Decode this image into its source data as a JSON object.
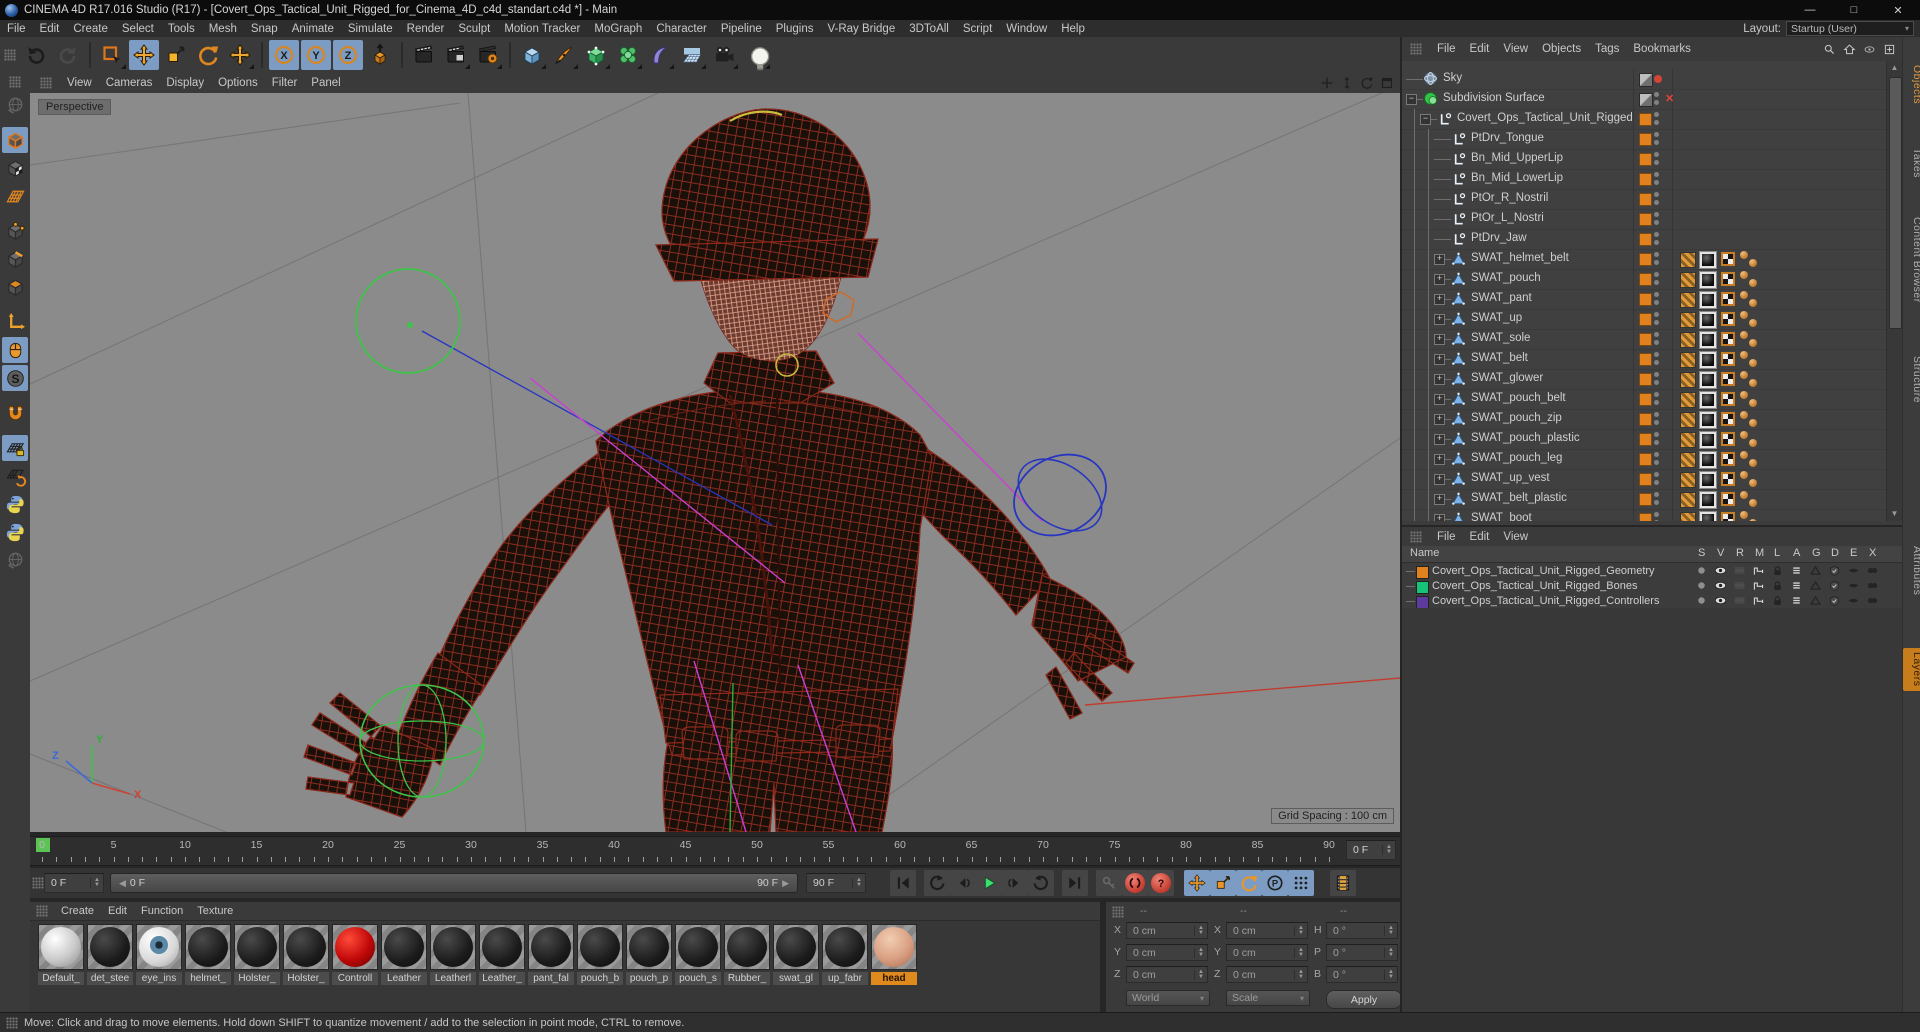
{
  "window": {
    "title": "CINEMA 4D R17.016 Studio (R17) - [Covert_Ops_Tactical_Unit_Rigged_for_Cinema_4D_c4d_standart.c4d *] - Main"
  },
  "menu_bar": {
    "items": [
      "File",
      "Edit",
      "Create",
      "Select",
      "Tools",
      "Mesh",
      "Snap",
      "Animate",
      "Simulate",
      "Render",
      "Sculpt",
      "Motion Tracker",
      "MoGraph",
      "Character",
      "Pipeline",
      "Plugins",
      "V-Ray Bridge",
      "3DToAll",
      "Script",
      "Window",
      "Help"
    ],
    "layout_label": "Layout:",
    "layout_value": "Startup (User)"
  },
  "toolbar": {
    "buttons": [
      {
        "name": "undo-button",
        "icon": "undo"
      },
      {
        "name": "redo-button",
        "icon": "redo",
        "state": "disabled"
      },
      {
        "sep": true
      },
      {
        "name": "selection-tool-button",
        "icon": "select",
        "corner": true
      },
      {
        "name": "move-tool-button",
        "icon": "move",
        "state": "active"
      },
      {
        "name": "scale-tool-button",
        "icon": "scale"
      },
      {
        "name": "rotate-tool-button",
        "icon": "rotate"
      },
      {
        "name": "last-used-tool-button",
        "icon": "move",
        "corner": true
      },
      {
        "sep": true
      },
      {
        "name": "lock-x-axis-button",
        "icon": "axisX",
        "state": "active"
      },
      {
        "name": "lock-y-axis-button",
        "icon": "axisY",
        "state": "active"
      },
      {
        "name": "lock-z-axis-button",
        "icon": "axisZ",
        "state": "active"
      },
      {
        "name": "coordinate-system-button",
        "icon": "cubearrow"
      },
      {
        "sep": true
      },
      {
        "name": "render-view-button",
        "icon": "clapper"
      },
      {
        "name": "render-picture-viewer-button",
        "icon": "clapperpv",
        "corner": true
      },
      {
        "name": "render-settings-button",
        "icon": "clappergear",
        "corner": true
      },
      {
        "sep": true
      },
      {
        "name": "add-cube-object-button",
        "icon": "cubeblue",
        "corner": true
      },
      {
        "name": "pen-spline-button",
        "icon": "pen",
        "corner": true
      },
      {
        "name": "subdivision-surface-button",
        "icon": "subdivgen",
        "corner": true
      },
      {
        "name": "array-generator-button",
        "icon": "cluster",
        "corner": true
      },
      {
        "name": "bend-deformer-button",
        "icon": "bend",
        "corner": true
      },
      {
        "name": "floor-environment-button",
        "icon": "floor",
        "corner": true
      },
      {
        "name": "camera-button",
        "icon": "camera",
        "corner": true
      },
      {
        "name": "light-button",
        "icon": "light",
        "corner": true
      }
    ]
  },
  "tool_palette": {
    "buttons": [
      {
        "name": "convert-tool-button",
        "icon": "globe",
        "state": "disabled"
      },
      {
        "gap": true
      },
      {
        "name": "model-mode-button",
        "icon": "modecube",
        "state": "active"
      },
      {
        "name": "texture-mode-button",
        "icon": "modetex"
      },
      {
        "name": "workplane-mode-button",
        "icon": "workplane"
      },
      {
        "gap": true
      },
      {
        "name": "points-mode-button",
        "icon": "modepoints"
      },
      {
        "name": "edges-mode-button",
        "icon": "modeedges"
      },
      {
        "name": "polygons-mode-button",
        "icon": "modepolys"
      },
      {
        "gap": true
      },
      {
        "name": "enable-axis-button",
        "icon": "modeaxis"
      },
      {
        "name": "tweak-mode-button",
        "icon": "mouse",
        "state": "active"
      },
      {
        "name": "snap-toggle-button",
        "icon": "snapS",
        "state": "active"
      },
      {
        "gap": true
      },
      {
        "name": "magnet-snap-button",
        "icon": "magnet"
      },
      {
        "gap": true
      },
      {
        "name": "lock-workplane-button",
        "icon": "planelock",
        "state": "active"
      },
      {
        "name": "workplane-rotate-button",
        "icon": "planerot"
      },
      {
        "name": "python-script-button",
        "icon": "python"
      },
      {
        "name": "python-script-2-button",
        "icon": "python"
      },
      {
        "name": "misc-tool-button",
        "icon": "globe",
        "state": "disabled"
      }
    ]
  },
  "viewport": {
    "menu": [
      "View",
      "Cameras",
      "Display",
      "Options",
      "Filter",
      "Panel"
    ],
    "view_label": "Perspective",
    "grid_spacing": "Grid Spacing : 100 cm"
  },
  "timeline": {
    "tick_labels": [
      "0",
      "5",
      "10",
      "15",
      "20",
      "25",
      "30",
      "35",
      "40",
      "45",
      "50",
      "55",
      "60",
      "65",
      "70",
      "75",
      "80",
      "85",
      "90"
    ],
    "frame_min": 0,
    "frame_max": 90,
    "current_frame": 0,
    "spinner_value": "0 F"
  },
  "transport": {
    "frame_field": "0 F",
    "slider_left_label": "0 F",
    "slider_right_label": "90 F",
    "end_field": "90 F",
    "buttons": [
      {
        "name": "goto-start-button",
        "icon": "skipstart"
      },
      {
        "name": "previous-key-button",
        "icon": "arcleft"
      },
      {
        "name": "previous-frame-button",
        "icon": "stepback"
      },
      {
        "name": "play-button",
        "icon": "play"
      },
      {
        "name": "next-frame-button",
        "icon": "stepfwd"
      },
      {
        "name": "next-key-button",
        "icon": "arcright"
      },
      {
        "name": "goto-end-button",
        "icon": "skipend"
      },
      {
        "name": "record-keyframe-button",
        "icon": "key",
        "state": "disabled"
      },
      {
        "name": "autokey-record-button",
        "icon": "record",
        "state": "red"
      },
      {
        "name": "keyframe-options-button",
        "icon": "question",
        "state": "red"
      },
      {
        "name": "key-position-button",
        "icon": "movekey",
        "state": "active"
      },
      {
        "name": "key-scale-button",
        "icon": "scalekey",
        "state": "active"
      },
      {
        "name": "key-rotation-button",
        "icon": "rotatekey",
        "state": "active"
      },
      {
        "name": "key-parameter-button",
        "icon": "pcircle",
        "state": "active"
      },
      {
        "name": "key-pla-button",
        "icon": "dotgrid",
        "state": "active"
      },
      {
        "name": "open-timeline-button",
        "icon": "film"
      }
    ]
  },
  "materials": {
    "menu": [
      "Create",
      "Edit",
      "Function",
      "Texture"
    ],
    "items": [
      {
        "label": "Default_",
        "type": "light"
      },
      {
        "label": "det_stee",
        "type": "dark"
      },
      {
        "label": "eye_ins",
        "type": "eye"
      },
      {
        "label": "helmet_",
        "type": "dark"
      },
      {
        "label": "Holster_",
        "type": "dark"
      },
      {
        "label": "Holster_",
        "type": "dark"
      },
      {
        "label": "Controll",
        "type": "red"
      },
      {
        "label": "Leather",
        "type": "dark"
      },
      {
        "label": "Leatherl",
        "type": "dark"
      },
      {
        "label": "Leather_",
        "type": "dark"
      },
      {
        "label": "pant_fal",
        "type": "dark"
      },
      {
        "label": "pouch_b",
        "type": "dark"
      },
      {
        "label": "pouch_p",
        "type": "dark"
      },
      {
        "label": "pouch_s",
        "type": "dark"
      },
      {
        "label": "Rubber_",
        "type": "dark"
      },
      {
        "label": "swat_gl",
        "type": "dark"
      },
      {
        "label": "up_fabr",
        "type": "dark"
      },
      {
        "label": "head",
        "type": "skin",
        "selected": true
      }
    ]
  },
  "coordinates": {
    "headers": [
      "--",
      "--",
      "--"
    ],
    "groups": [
      {
        "rows": [
          [
            "X",
            "0 cm"
          ],
          [
            "Y",
            "0 cm"
          ],
          [
            "Z",
            "0 cm"
          ]
        ],
        "combo": "World"
      },
      {
        "rows": [
          [
            "X",
            "0 cm"
          ],
          [
            "Y",
            "0 cm"
          ],
          [
            "Z",
            "0 cm"
          ]
        ],
        "combo": "Scale"
      },
      {
        "rows": [
          [
            "H",
            "0 °"
          ],
          [
            "P",
            "0 °"
          ],
          [
            "B",
            "0 °"
          ]
        ],
        "button": "Apply"
      }
    ]
  },
  "object_manager": {
    "menu": [
      "File",
      "Edit",
      "View",
      "Objects",
      "Tags",
      "Bookmarks"
    ],
    "tree": [
      {
        "label": "Sky",
        "icon": "sky-object-icon",
        "depth": 0,
        "tags": [
          "graytag",
          "reddot"
        ]
      },
      {
        "label": "Subdivision Surface",
        "icon": "subdivision-object-icon",
        "depth": 0,
        "expand": "open",
        "tags": [
          "graytag",
          "visdots",
          "redx"
        ]
      },
      {
        "label": "Covert_Ops_Tactical_Unit_Rigged",
        "icon": "null-object-icon",
        "depth": 1,
        "expand": "open",
        "tags": [
          "layersq",
          "visdots"
        ]
      },
      {
        "label": "PtDrv_Tongue",
        "icon": "null-object-icon",
        "depth": 2,
        "tags": [
          "layersq",
          "visdots"
        ]
      },
      {
        "label": "Bn_Mid_UpperLip",
        "icon": "null-object-icon",
        "depth": 2,
        "tags": [
          "layersq",
          "visdots"
        ]
      },
      {
        "label": "Bn_Mid_LowerLip",
        "icon": "null-object-icon",
        "depth": 2,
        "tags": [
          "layersq",
          "visdots"
        ]
      },
      {
        "label": "PtOr_R_Nostril",
        "icon": "null-object-icon",
        "depth": 2,
        "tags": [
          "layersq",
          "visdots"
        ]
      },
      {
        "label": "PtOr_L_Nostri",
        "icon": "null-object-icon",
        "depth": 2,
        "tags": [
          "layersq",
          "visdots"
        ]
      },
      {
        "label": "PtDrv_Jaw",
        "icon": "null-object-icon",
        "depth": 2,
        "tags": [
          "layersq",
          "visdots"
        ]
      },
      {
        "label": "SWAT_helmet_belt",
        "icon": "polygon-object-icon",
        "depth": 2,
        "expand": "closed",
        "tags": [
          "layersq",
          "visdots",
          "wtag",
          "mattag",
          "uvwtag",
          "balls"
        ]
      },
      {
        "label": "SWAT_pouch",
        "icon": "polygon-object-icon",
        "depth": 2,
        "expand": "closed",
        "tags": [
          "layersq",
          "visdots",
          "wtag",
          "mattag",
          "uvwtag",
          "balls"
        ]
      },
      {
        "label": "SWAT_pant",
        "icon": "polygon-object-icon",
        "depth": 2,
        "expand": "closed",
        "tags": [
          "layersq",
          "visdots",
          "wtag",
          "mattag",
          "uvwtag",
          "balls"
        ]
      },
      {
        "label": "SWAT_up",
        "icon": "polygon-object-icon",
        "depth": 2,
        "expand": "closed",
        "tags": [
          "layersq",
          "visdots",
          "wtag",
          "mattag",
          "uvwtag",
          "balls"
        ]
      },
      {
        "label": "SWAT_sole",
        "icon": "polygon-object-icon",
        "depth": 2,
        "expand": "closed",
        "tags": [
          "layersq",
          "visdots",
          "wtag",
          "mattag",
          "uvwtag",
          "balls"
        ]
      },
      {
        "label": "SWAT_belt",
        "icon": "polygon-object-icon",
        "depth": 2,
        "expand": "closed",
        "tags": [
          "layersq",
          "visdots",
          "wtag",
          "mattag",
          "uvwtag",
          "balls"
        ]
      },
      {
        "label": "SWAT_glower",
        "icon": "polygon-object-icon",
        "depth": 2,
        "expand": "closed",
        "tags": [
          "layersq",
          "visdots",
          "wtag",
          "mattag",
          "uvwtag",
          "balls"
        ]
      },
      {
        "label": "SWAT_pouch_belt",
        "icon": "polygon-object-icon",
        "depth": 2,
        "expand": "closed",
        "tags": [
          "layersq",
          "visdots",
          "wtag",
          "mattag",
          "uvwtag",
          "balls"
        ]
      },
      {
        "label": "SWAT_pouch_zip",
        "icon": "polygon-object-icon",
        "dep th": 2,
        "depth": 2,
        "expand": "closed",
        "tags": [
          "layersq",
          "visdots",
          "wtag",
          "mattag",
          "uvwtag",
          "balls"
        ]
      },
      {
        "label": "SWAT_pouch_plastic",
        "icon": "polygon-object-icon",
        "depth": 2,
        "expand": "closed",
        "tags": [
          "layersq",
          "visdots",
          "wtag",
          "mattag",
          "uvwtag",
          "balls"
        ]
      },
      {
        "label": "SWAT_pouch_leg",
        "icon": "polygon-object-icon",
        "depth": 2,
        "expand": "closed",
        "tags": [
          "layersq",
          "visdots",
          "wtag",
          "mattag",
          "uvwtag",
          "balls"
        ]
      },
      {
        "label": "SWAT_up_vest",
        "icon": "polygon-object-icon",
        "depth": 2,
        "expand": "closed",
        "tags": [
          "layersq",
          "visdots",
          "wtag",
          "mattag",
          "uvwtag",
          "balls"
        ]
      },
      {
        "label": "SWAT_belt_plastic",
        "icon": "polygon-object-icon",
        "depth": 2,
        "expand": "closed",
        "tags": [
          "layersq",
          "visdots",
          "wtag",
          "mattag",
          "uvwtag",
          "balls"
        ]
      },
      {
        "label": "SWAT_boot",
        "icon": "polygon-object-icon",
        "depth": 2,
        "expand": "closed",
        "tags": [
          "layersq",
          "visdots",
          "wtag",
          "mattag",
          "uvwtag",
          "balls"
        ]
      }
    ]
  },
  "layer_manager": {
    "menu": [
      "File",
      "Edit",
      "View"
    ],
    "name_column": "Name",
    "columns": [
      "S",
      "V",
      "R",
      "M",
      "L",
      "A",
      "G",
      "D",
      "E",
      "X"
    ],
    "rows": [
      {
        "color": "#e0801e",
        "label": "Covert_Ops_Tactical_Unit_Rigged_Geometry"
      },
      {
        "color": "#16c278",
        "label": "Covert_Ops_Tactical_Unit_Rigged_Bones"
      },
      {
        "color": "#5c3a9e",
        "label": "Covert_Ops_Tactical_Unit_Rigged_Controllers"
      }
    ]
  },
  "side_tabs": {
    "top": [
      "Objects",
      "Takes",
      "Content Browser",
      "Structure"
    ],
    "active_top": "Objects",
    "bottom": [
      "Attributes",
      "Layers"
    ],
    "active_bottom": "Layers"
  },
  "status_bar": {
    "text": "Move: Click and drag to move elements. Hold down SHIFT to quantize movement / add to the selection in point mode, CTRL to remove."
  },
  "colors": {
    "accent_orange": "#e0871f",
    "selection_blue": "#7c9cc4",
    "wire_red": "#a93226",
    "controller_green": "#3fc44a",
    "controller_blue": "#2636c0",
    "ik_magenta": "#cc3fd0",
    "viewport_gray": "#8b8b8b"
  }
}
